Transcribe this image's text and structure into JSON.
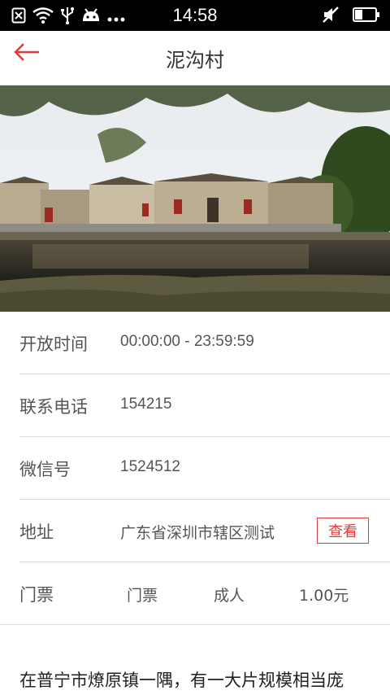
{
  "status_bar": {
    "time": "14:58",
    "icons_left": [
      "sim-error-icon",
      "wifi-icon",
      "usb-icon",
      "android-icon",
      "more-dots-icon"
    ],
    "icons_right": [
      "mute-icon",
      "battery-icon"
    ]
  },
  "header": {
    "title": "泥沟村",
    "back_icon": "back-arrow-icon",
    "accent": "#e23c3c"
  },
  "hero_image": {
    "alt": "village-photo"
  },
  "info": {
    "hours": {
      "label": "开放时间",
      "value": "00:00:00 - 23:59:59"
    },
    "phone": {
      "label": "联系电话",
      "value": "154215"
    },
    "wechat": {
      "label": "微信号",
      "value": "1524512"
    },
    "address": {
      "label": "地址",
      "value": "广东省深圳市辖区测试",
      "button": "查看"
    },
    "ticket": {
      "label": "门票",
      "type": "门票",
      "audience": "成人",
      "price": "1.00元"
    }
  },
  "description": "在普宁市燎原镇一隅，有一大片规模相当庞"
}
